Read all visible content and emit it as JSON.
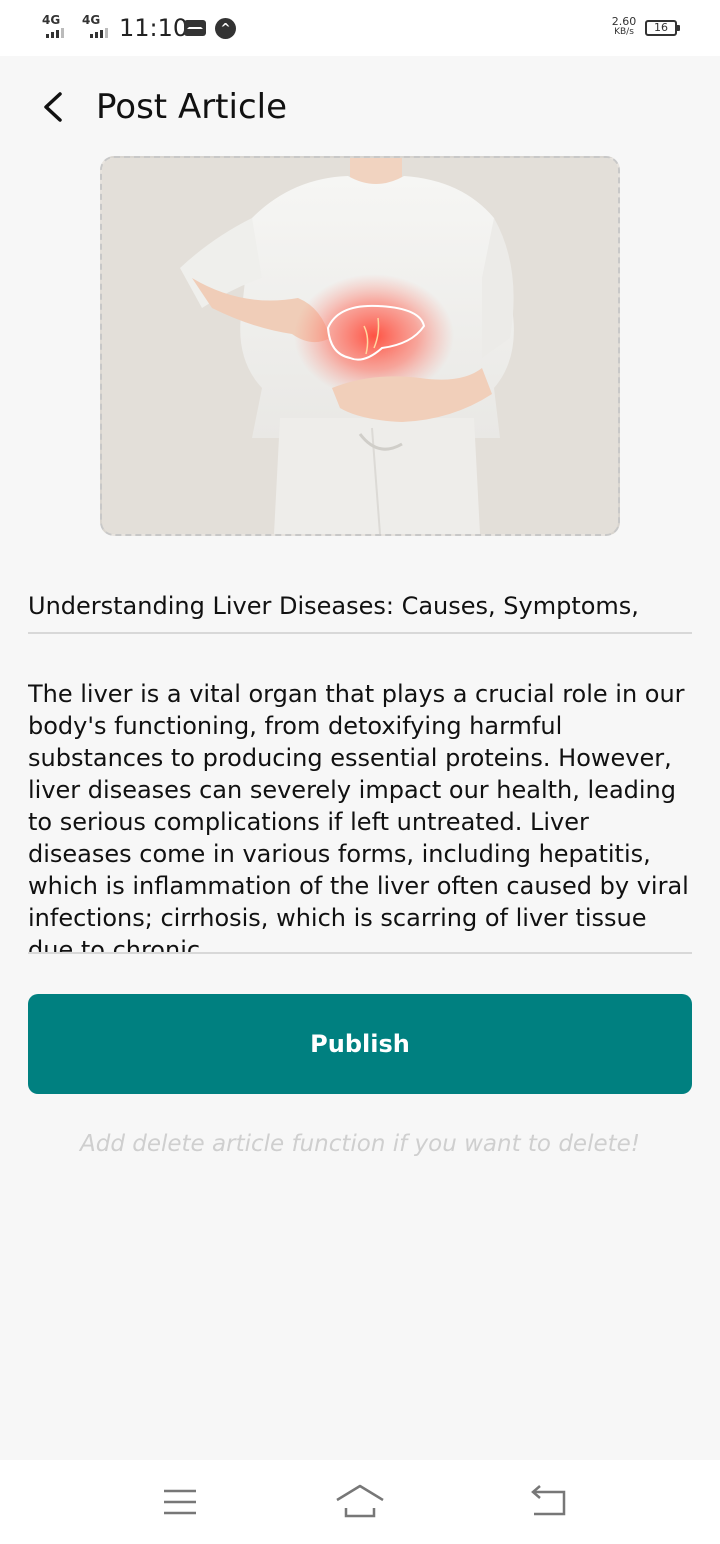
{
  "status_bar": {
    "network_1": "4G",
    "network_2": "4G",
    "time": "11:10",
    "speed_value": "2.60",
    "speed_unit": "KB/s",
    "battery": "16"
  },
  "header": {
    "title": "Post Article"
  },
  "article": {
    "title_value": "Understanding Liver Diseases: Causes, Symptoms,",
    "body_value": "The liver is a vital organ that plays a crucial role in our body's functioning, from detoxifying harmful substances to producing essential proteins. However, liver diseases can severely impact our health, leading to serious complications if left untreated. Liver diseases come in various forms, including hepatitis, which is inflammation of the liver often caused by viral infections; cirrhosis, which is scarring of liver tissue due to chronic"
  },
  "actions": {
    "publish_label": "Publish",
    "hint": "Add delete article function if you want to delete!"
  },
  "colors": {
    "accent": "#008080",
    "background": "#f7f7f7",
    "hint": "#cfcfcf"
  },
  "icons": {
    "back": "chevron-left-icon",
    "menu": "menu-icon",
    "home": "home-icon",
    "return": "return-icon"
  }
}
